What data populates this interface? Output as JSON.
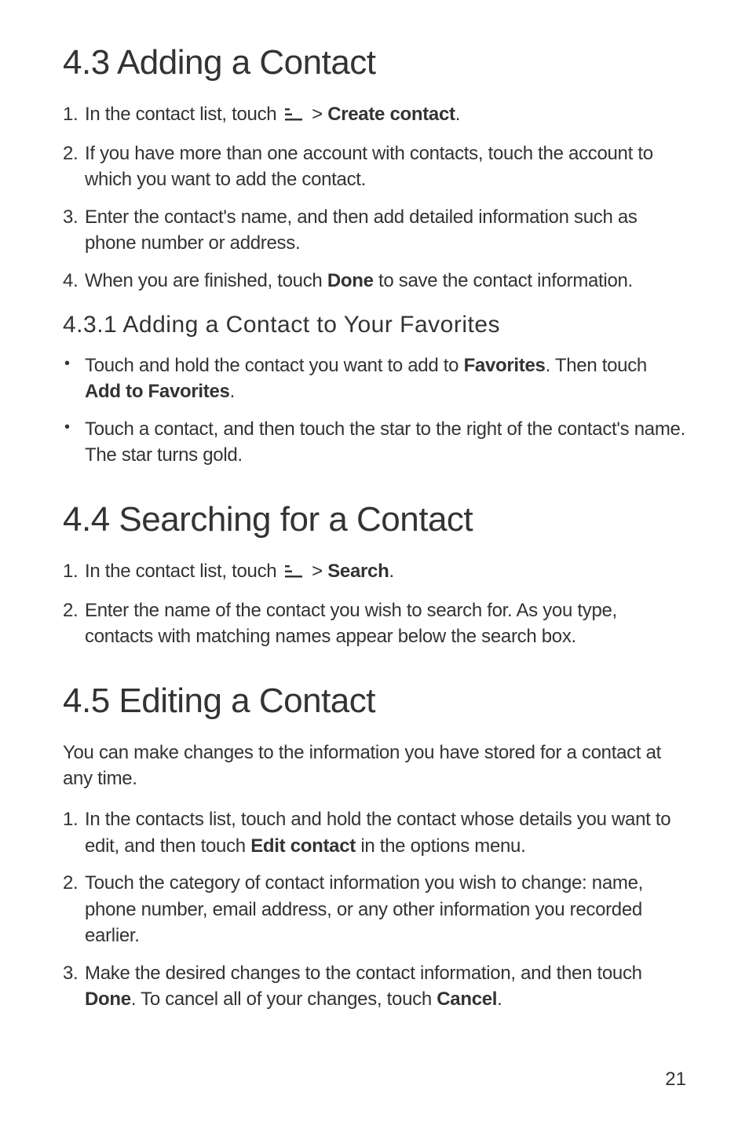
{
  "sec43": {
    "heading": "4.3  Adding a Contact",
    "steps": [
      {
        "n": "1.",
        "pre": "In the contact list, touch ",
        "post": " > ",
        "bold": "Create contact",
        "after": "."
      },
      {
        "n": "2.",
        "text": "If you have more than one account with contacts, touch the account to which you want to add the contact."
      },
      {
        "n": "3.",
        "text": "Enter the contact's name, and then add detailed information such as phone number or address."
      },
      {
        "n": "4.",
        "pre": "When you are finished, touch ",
        "bold": "Done",
        "after": " to save the contact information."
      }
    ],
    "sub": {
      "heading": "4.3.1   Adding a Contact to Your Favorites",
      "bullets": [
        {
          "pre": "Touch and hold the contact you want to add to ",
          "b1": "Favorites",
          "mid": ". Then touch ",
          "b2": "Add to Favorites",
          "after": "."
        },
        {
          "text": "Touch a contact, and then touch the star to the right of the contact's name. The star turns gold."
        }
      ]
    }
  },
  "sec44": {
    "heading": "4.4  Searching for a Contact",
    "steps": [
      {
        "n": "1.",
        "pre": "In the contact list, touch ",
        "post": " > ",
        "bold": "Search",
        "after": "."
      },
      {
        "n": "2.",
        "text": "Enter the name of the contact you wish to search for. As you type, contacts with matching names appear below the search box."
      }
    ]
  },
  "sec45": {
    "heading": "4.5  Editing a Contact",
    "intro": "You can make changes to the information you have stored for a contact at any time.",
    "steps": [
      {
        "n": "1.",
        "pre": "In the contacts list, touch and hold the contact whose details you want to edit, and then touch ",
        "bold": "Edit contact",
        "after": " in the options menu."
      },
      {
        "n": "2.",
        "text": "Touch the category of contact information you wish to change: name, phone number, email address, or any other information you recorded earlier."
      },
      {
        "n": "3.",
        "pre": "Make the desired changes to the contact information, and then touch ",
        "b1": "Done",
        "mid": ". To cancel all of your changes, touch ",
        "b2": "Cancel",
        "after": "."
      }
    ]
  },
  "page_number": "21"
}
